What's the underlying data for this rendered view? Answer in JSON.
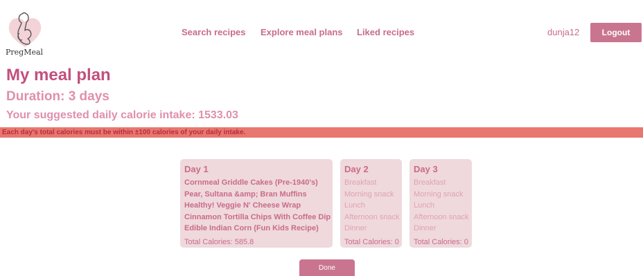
{
  "brand": {
    "name": "PregMeal"
  },
  "nav": {
    "links": [
      {
        "label": "Search recipes"
      },
      {
        "label": "Explore meal plans"
      },
      {
        "label": "Liked recipes"
      }
    ]
  },
  "user": {
    "username": "dunja12",
    "logout_label": "Logout"
  },
  "plan": {
    "title": "My meal plan",
    "duration": "Duration: 3 days",
    "calorie_intake": "Your suggested daily calorie intake: 1533.03",
    "warning": "Each day's total calories must be within ±100 calories of your daily intake."
  },
  "days": [
    {
      "title": "Day 1",
      "meals": [
        "Cornmeal Griddle Cakes (Pre-1940's)",
        "Pear, Sultana &amp; Bran Muffins",
        "Healthy! Veggie N' Cheese Wrap",
        "Cinnamon Tortilla Chips With Coffee Dip",
        "Edible Indian Corn (Fun Kids Recipe)"
      ],
      "total": "Total Calories: 585.8"
    },
    {
      "title": "Day 2",
      "meals": [
        "Breakfast",
        "Morning snack",
        "Lunch",
        "Afternoon snack",
        "Dinner"
      ],
      "total": "Total Calories: 0"
    },
    {
      "title": "Day 3",
      "meals": [
        "Breakfast",
        "Morning snack",
        "Lunch",
        "Afternoon snack",
        "Dinner"
      ],
      "total": "Total Calories: 0"
    }
  ],
  "actions": {
    "done_label": "Done"
  },
  "colors": {
    "accent": "#c96b8b",
    "title": "#c24f7e",
    "subtitle": "#e08fac",
    "card": "#efd9dc",
    "warning_bg": "#e8776f",
    "warning_text": "#b52d3f",
    "button": "#c97590"
  }
}
